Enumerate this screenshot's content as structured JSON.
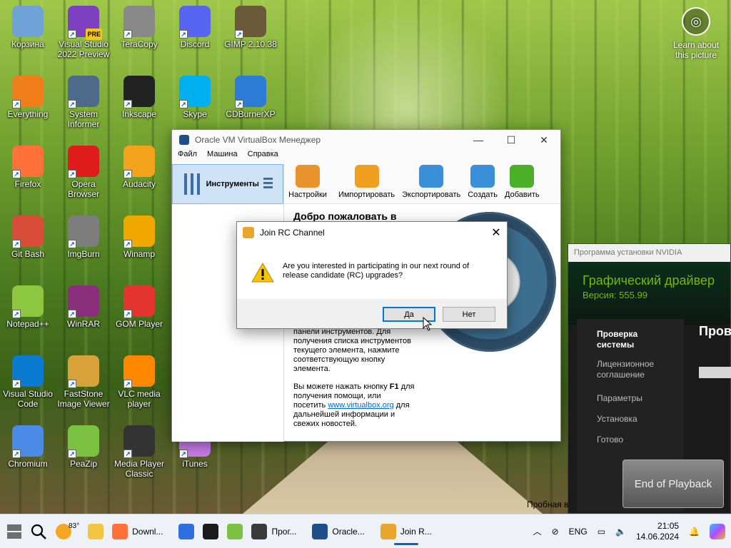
{
  "desktop": {
    "icons": [
      {
        "label": "Корзина",
        "name": "recycle-bin-icon",
        "color": "#6fa3d8"
      },
      {
        "label": "Visual Studio 2022 Preview",
        "name": "visual-studio-icon",
        "color": "#7b3fbf",
        "badge": "PRE"
      },
      {
        "label": "TeraCopy",
        "name": "teracopy-icon",
        "color": "#888888"
      },
      {
        "label": "Discord",
        "name": "discord-icon",
        "color": "#5865f2"
      },
      {
        "label": "GIMP 2.10.38",
        "name": "gimp-icon",
        "color": "#6b5a3a"
      },
      {
        "label": "Everything",
        "name": "everything-icon",
        "color": "#f07f1a"
      },
      {
        "label": "System Informer",
        "name": "system-informer-icon",
        "color": "#4d6a8a"
      },
      {
        "label": "Inkscape",
        "name": "inkscape-icon",
        "color": "#222222"
      },
      {
        "label": "Skype",
        "name": "skype-icon",
        "color": "#00aff0"
      },
      {
        "label": "CDBurnerXP",
        "name": "cdburnerxp-icon",
        "color": "#2c7bd6"
      },
      {
        "label": "Firefox",
        "name": "firefox-icon",
        "color": "#ff7139"
      },
      {
        "label": "Opera Browser",
        "name": "opera-icon",
        "color": "#e01b1b"
      },
      {
        "label": "Audacity",
        "name": "audacity-icon",
        "color": "#f2a31b"
      },
      {
        "label": "Git Bash",
        "name": "git-bash-icon",
        "color": "#d94c3a"
      },
      {
        "label": "ImgBurn",
        "name": "imgburn-icon",
        "color": "#7d7d7d"
      },
      {
        "label": "Winamp",
        "name": "winamp-icon",
        "color": "#f0a800"
      },
      {
        "label": "Notepad++",
        "name": "notepad-plus-plus-icon",
        "color": "#8dc63f"
      },
      {
        "label": "WinRAR",
        "name": "winrar-icon",
        "color": "#8b2f7d"
      },
      {
        "label": "GOM Player",
        "name": "gom-player-icon",
        "color": "#e3342f"
      },
      {
        "label": "Visual Studio Code",
        "name": "vscode-icon",
        "color": "#0b7ad1"
      },
      {
        "label": "FastStone Image Viewer",
        "name": "faststone-icon",
        "color": "#d9a13a"
      },
      {
        "label": "VLC media player",
        "name": "vlc-icon",
        "color": "#ff8800"
      },
      {
        "label": "Chromium",
        "name": "chromium-icon",
        "color": "#4a8be8"
      },
      {
        "label": "PeaZip",
        "name": "peazip-icon",
        "color": "#7cc242"
      },
      {
        "label": "Media Player Classic",
        "name": "mpc-icon",
        "color": "#333333"
      },
      {
        "label": "iTunes",
        "name": "itunes-icon",
        "color": "#c77be8"
      }
    ],
    "learn_label": "Learn about this picture"
  },
  "vbox": {
    "title": "Oracle VM VirtualBox Менеджер",
    "menu": [
      "Файл",
      "Машина",
      "Справка"
    ],
    "tools_label": "Инструменты",
    "toolbar": [
      {
        "label": "Настройки",
        "name": "settings-button",
        "color": "#e8932c"
      },
      {
        "label": "Импортировать",
        "name": "import-button",
        "color": "#f0a020"
      },
      {
        "label": "Экспортировать",
        "name": "export-button",
        "color": "#3b8ed8"
      },
      {
        "label": "Создать",
        "name": "create-button",
        "color": "#3a90d8"
      },
      {
        "label": "Добавить",
        "name": "add-button",
        "color": "#4caf2a"
      }
    ],
    "welcome": "Добро пожаловать в",
    "text1_a": "панели инструментов. Для получения списка инструментов текущего элемента, нажмите соответствующую кнопку элемента.",
    "text2_a": "Вы можете нажать кнопку",
    "text2_key": "F1",
    "text2_b": "для получения помощи, или посетить",
    "text2_link": "www.virtualbox.org",
    "text2_c": "для дальнейшей информации и свежих новостей."
  },
  "nvidia": {
    "header": "Программа установки NVIDIA",
    "title": "Графический драйвер",
    "version": "Версия: 555.99",
    "nav": [
      "Проверка системы",
      "Лицензионное соглашение",
      "Параметры",
      "Установка",
      "Готово"
    ],
    "right_title": "Пров",
    "trial": "Пробная в"
  },
  "playback": "End of Playback",
  "dialog": {
    "title": "Join RC Channel",
    "message": "Are you interested in participating in our next round of release candidate (RC) upgrades?",
    "yes": "Да",
    "no": "Нет"
  },
  "taskbar": {
    "weather": "83°",
    "items": [
      {
        "label": "Downl...",
        "name": "taskbar-firefox-download",
        "color": "#ff7139"
      },
      {
        "label": "",
        "name": "taskbar-store",
        "color": "#2f6ee0"
      },
      {
        "label": "",
        "name": "taskbar-iphone-app",
        "color": "#1a1a1a"
      },
      {
        "label": "",
        "name": "taskbar-app-tb",
        "color": "#7cc242"
      },
      {
        "label": "Прог...",
        "name": "taskbar-nvidia-installer",
        "color": "#3a3a3a"
      },
      {
        "label": "Oracle...",
        "name": "taskbar-virtualbox",
        "color": "#1f4f8a"
      },
      {
        "label": "Join R...",
        "name": "taskbar-join-rc",
        "color": "#e8a72c"
      }
    ],
    "lang": "ENG",
    "time": "21:05",
    "date": "14.06.2024"
  }
}
